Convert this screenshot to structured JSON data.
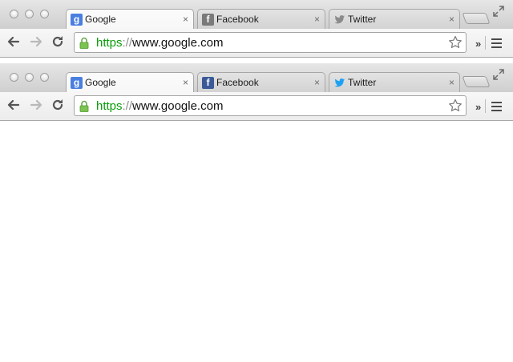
{
  "browsers": [
    {
      "tabs": [
        {
          "label": "Google",
          "close": "×",
          "favicon": "google-favicon-icon",
          "active": true
        },
        {
          "label": "Facebook",
          "close": "×",
          "favicon": "facebook-favicon-icon",
          "active": false
        },
        {
          "label": "Twitter",
          "close": "×",
          "favicon": "twitter-favicon-icon",
          "active": false
        }
      ],
      "url": {
        "scheme": "https",
        "separator": "://",
        "host": "www.google.com"
      },
      "overflow_label": "»"
    },
    {
      "tabs": [
        {
          "label": "Google",
          "close": "×",
          "favicon": "google-favicon-icon",
          "active": true
        },
        {
          "label": "Facebook",
          "close": "×",
          "favicon": "facebook-favicon-icon",
          "active": false
        },
        {
          "label": "Twitter",
          "close": "×",
          "favicon": "twitter-favicon-icon",
          "active": false
        }
      ],
      "url": {
        "scheme": "https",
        "separator": "://",
        "host": "www.google.com"
      },
      "overflow_label": "»"
    }
  ],
  "colors": {
    "scheme_secure": "#089d08",
    "google_blue": "#4a7fe0",
    "facebook_blue": "#3b5998",
    "twitter_blue": "#1da1f2",
    "inactive_gray": "#7a7a7a"
  }
}
